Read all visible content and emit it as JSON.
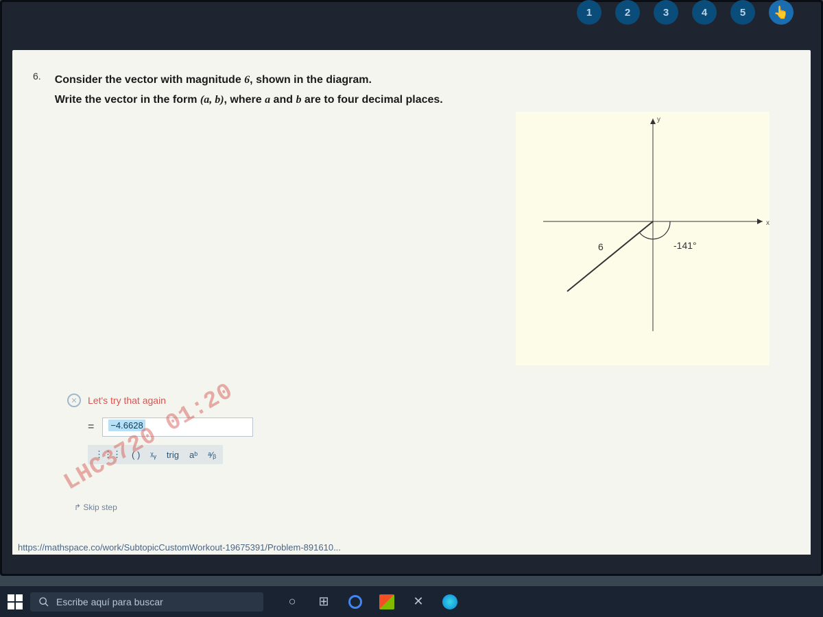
{
  "nav": {
    "dots": [
      "1",
      "2",
      "3",
      "4",
      "5"
    ]
  },
  "question": {
    "number": "6.",
    "line1_prefix": "Consider the vector with magnitude ",
    "magnitude": "6",
    "line1_suffix": ", shown in the diagram.",
    "line2_prefix": "Write the vector in the form ",
    "form_open": "(",
    "form_a": "a",
    "form_sep": ", ",
    "form_b": "b",
    "form_close": ")",
    "line2_mid": ", where ",
    "var_a": "a",
    "line2_and": " and ",
    "var_b": "b",
    "line2_suffix": " are to four decimal places."
  },
  "diagram": {
    "magnitude_label": "6",
    "angle_label": "-141°",
    "y_axis": "y",
    "x_axis": "x"
  },
  "feedback": {
    "close": "✕",
    "message": "Let's try that again"
  },
  "answer": {
    "equals": "=",
    "value": "−4.6628"
  },
  "toolbar": {
    "keypad": "⋮⋮⋮",
    "paren": "( )",
    "special": "ᵡᵧ",
    "trig": "trig",
    "power": "aᵇ",
    "frac": "ᵃ⁄ᵦ"
  },
  "skip": "Skip step",
  "url": "https://mathspace.co/work/SubtopicCustomWorkout-19675391/Problem-891610...",
  "watermark": "LHC3720  01:20",
  "taskbar": {
    "search_placeholder": "Escribe aquí para buscar"
  }
}
